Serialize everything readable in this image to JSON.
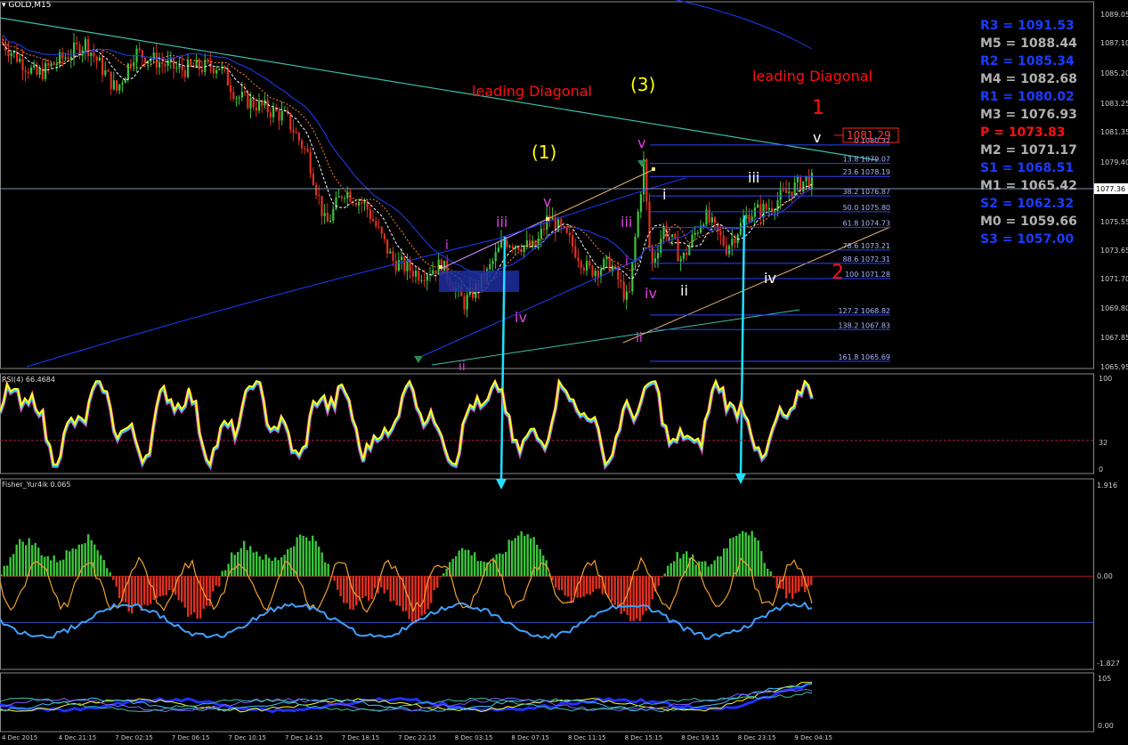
{
  "header": {
    "symbol": "GOLD,M15"
  },
  "colors": {
    "bg": "#000000",
    "up": "#3cc43c",
    "down": "#e03020",
    "grid": "#444444",
    "trend": "#3fbfa8",
    "piv_blue": "#1a3cff",
    "piv_gray": "#b0b0b0",
    "piv_red": "#ff1010"
  },
  "chart_data": [
    {
      "type": "candlestick",
      "title": "GOLD,M15",
      "ylim": [
        1065.2,
        1090.0
      ],
      "y_ticks": [
        "1089.05",
        "1087.10",
        "1085.20",
        "1083.25",
        "1081.35",
        "1079.40",
        "1077.36",
        "1075.55",
        "1073.65",
        "1071.70",
        "1069.80",
        "1067.85",
        "1065.95"
      ],
      "current_price": "1077.36",
      "price_tag": "1081.29",
      "pivots": [
        {
          "label": "R3 = 1091.53",
          "value": 1091.53,
          "color": "blue"
        },
        {
          "label": "M5 = 1088.44",
          "value": 1088.44,
          "color": "gray"
        },
        {
          "label": "R2 = 1085.34",
          "value": 1085.34,
          "color": "blue"
        },
        {
          "label": "M4 = 1082.68",
          "value": 1082.68,
          "color": "gray"
        },
        {
          "label": "R1 = 1080.02",
          "value": 1080.02,
          "color": "blue"
        },
        {
          "label": "M3 = 1076.93",
          "value": 1076.93,
          "color": "gray"
        },
        {
          "label": "P  = 1073.83",
          "value": 1073.83,
          "color": "red"
        },
        {
          "label": "M2 = 1071.17",
          "value": 1071.17,
          "color": "gray"
        },
        {
          "label": "S1 = 1068.51",
          "value": 1068.51,
          "color": "blue"
        },
        {
          "label": "M1 = 1065.42",
          "value": 1065.42,
          "color": "gray"
        },
        {
          "label": "S2 = 1062.32",
          "value": 1062.32,
          "color": "blue"
        },
        {
          "label": "M0 = 1059.66",
          "value": 1059.66,
          "color": "gray"
        },
        {
          "label": "S3 = 1057.00",
          "value": 1057.0,
          "color": "blue"
        }
      ],
      "fib_levels": [
        {
          "label": "0 1080.32",
          "value": 1080.32
        },
        {
          "label": "13.8 1079.07",
          "value": 1079.07
        },
        {
          "label": "23.6 1078.19",
          "value": 1078.19
        },
        {
          "label": "38.2 1076.87",
          "value": 1076.87
        },
        {
          "label": "50.0 1075.80",
          "value": 1075.8
        },
        {
          "label": "61.8 1074.73",
          "value": 1074.73
        },
        {
          "label": "78.6 1073.21",
          "value": 1073.21
        },
        {
          "label": "88.6 1072.31",
          "value": 1072.31
        },
        {
          "label": "100 1071.28",
          "value": 1071.28
        },
        {
          "label": "127.2 1068.82",
          "value": 1068.82
        },
        {
          "label": "138.2 1067.83",
          "value": 1067.83
        },
        {
          "label": "161.8 1065.69",
          "value": 1065.69
        }
      ],
      "annotations": [
        {
          "text": "leading Diagonal",
          "color": "#ff1010"
        },
        {
          "text": "leading Diagonal",
          "color": "#ff1010"
        },
        {
          "text": "(3)",
          "color": "#ffff00"
        },
        {
          "text": "(1)",
          "color": "#ffff00"
        },
        {
          "text": "1",
          "color": "#ff1010"
        },
        {
          "text": "2",
          "color": "#ff1010"
        },
        {
          "text": "v",
          "color": "#e040e0"
        },
        {
          "text": "v",
          "color": "#e040e0"
        },
        {
          "text": "v",
          "color": "#ffffff"
        },
        {
          "text": "iii",
          "color": "#e040e0"
        },
        {
          "text": "iii",
          "color": "#e040e0"
        },
        {
          "text": "iii",
          "color": "#ffffff"
        },
        {
          "text": "i",
          "color": "#e040e0"
        },
        {
          "text": "i",
          "color": "#e040e0"
        },
        {
          "text": "i",
          "color": "#ffffff"
        },
        {
          "text": "ii",
          "color": "#e040e0"
        },
        {
          "text": "ii",
          "color": "#e040e0"
        },
        {
          "text": "ii",
          "color": "#ffffff"
        },
        {
          "text": "iv",
          "color": "#e040e0"
        },
        {
          "text": "iv",
          "color": "#e040e0"
        },
        {
          "text": "iv",
          "color": "#ffffff"
        }
      ],
      "x_labels": [
        "4 Dec 2015",
        "4 Dec 21:15",
        "7 Dec 02:15",
        "7 Dec 06:15",
        "7 Dec 10:15",
        "7 Dec 14:15",
        "7 Dec 18:15",
        "7 Dec 22:15",
        "8 Dec 03:15",
        "8 Dec 07:15",
        "8 Dec 11:15",
        "8 Dec 15:15",
        "8 Dec 19:15",
        "8 Dec 23:15",
        "9 Dec 04:15"
      ]
    },
    {
      "type": "line",
      "title": "RSI(4) 66.4684",
      "ylim": [
        0,
        100
      ],
      "y_ticks": [
        "100",
        "32",
        "0"
      ],
      "level": 32
    },
    {
      "type": "bar",
      "title": "Fisher_Yur4ik 0.065",
      "ylim": [
        -1.827,
        1.916
      ],
      "y_ticks": [
        "1.916",
        "0.00",
        "-1.827"
      ]
    },
    {
      "type": "line",
      "title": "",
      "y_ticks": [
        "105",
        "0.00"
      ]
    }
  ]
}
